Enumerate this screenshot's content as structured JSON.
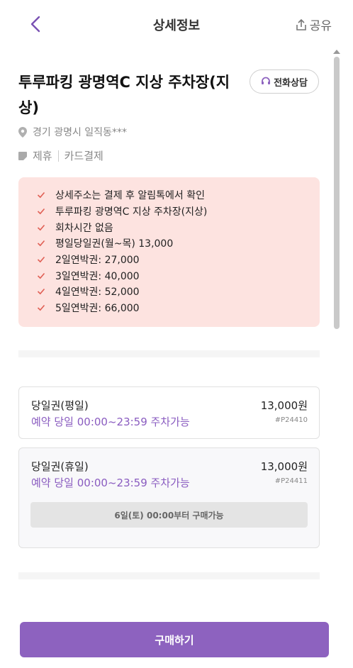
{
  "header": {
    "title": "상세정보",
    "share_label": "공유"
  },
  "parking": {
    "name": "투루파킹 광명역C 지상 주차장(지상)",
    "phone_label": "전화상담",
    "address": "경기 광명시 일직동***",
    "tags": [
      "제휴",
      "카드결제"
    ]
  },
  "notice": {
    "items": [
      "상세주소는 결제 후 알림톡에서 확인",
      "투루파킹 광명역C 지상 주차장(지상)",
      "회차시간 없음",
      "평일당일권(월~목) 13,000",
      "2일연박권: 27,000",
      "3일연박권: 40,000",
      "4일연박권: 52,000",
      "5일연박권: 66,000"
    ]
  },
  "tickets": [
    {
      "name": "당일권(평일)",
      "price": "13,000원",
      "time": "예약 당일 00:00~23:59 주차가능",
      "code": "#P24410"
    },
    {
      "name": "당일권(휴일)",
      "price": "13,000원",
      "time": "예약 당일 00:00~23:59 주차가능",
      "code": "#P24411",
      "availability": "6일(토) 00:00부터 구매가능"
    }
  ],
  "footer": {
    "buy_label": "구매하기"
  },
  "colors": {
    "accent": "#8d62bf",
    "notice_bg": "#fde3e0",
    "check": "#e06055"
  }
}
